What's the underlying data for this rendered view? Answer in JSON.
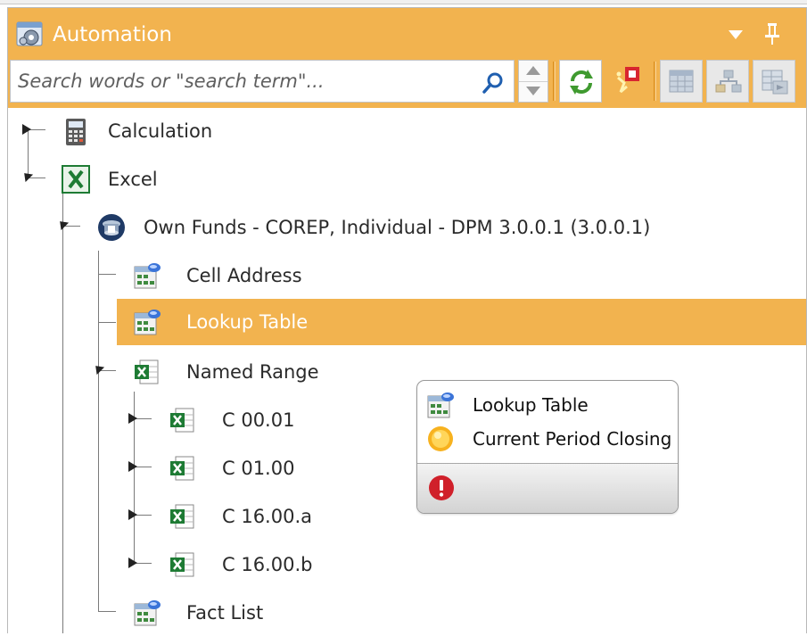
{
  "panel": {
    "title": "Automation",
    "icons": {
      "title": "automation-gear-icon",
      "dropdown": "dropdown-triangle-icon",
      "pin": "pin-icon"
    }
  },
  "toolbar": {
    "search_placeholder": "Search words or \"search term\"...",
    "search_value": "",
    "buttons": [
      "refresh-icon",
      "highlight-toggle-icon",
      "grid-icon",
      "flowchart-icon",
      "table-export-icon"
    ]
  },
  "tree": {
    "calculation": "Calculation",
    "excel": "Excel",
    "own_funds": "Own Funds - COREP, Individual - DPM 3.0.0.1 (3.0.0.1)",
    "cell_address": "Cell Address",
    "lookup_table": "Lookup Table",
    "named_range": "Named Range",
    "c0001": "C 00.01",
    "c0100": "C 01.00",
    "c1600a": "C 16.00.a",
    "c1600b": "C 16.00.b",
    "fact_list": "Fact List"
  },
  "popup": {
    "item1": "Lookup Table",
    "item2": "Current Period Closing"
  },
  "colors": {
    "accent": "#f2b34f",
    "selected_text": "#ffffff",
    "error": "#d0202a"
  }
}
